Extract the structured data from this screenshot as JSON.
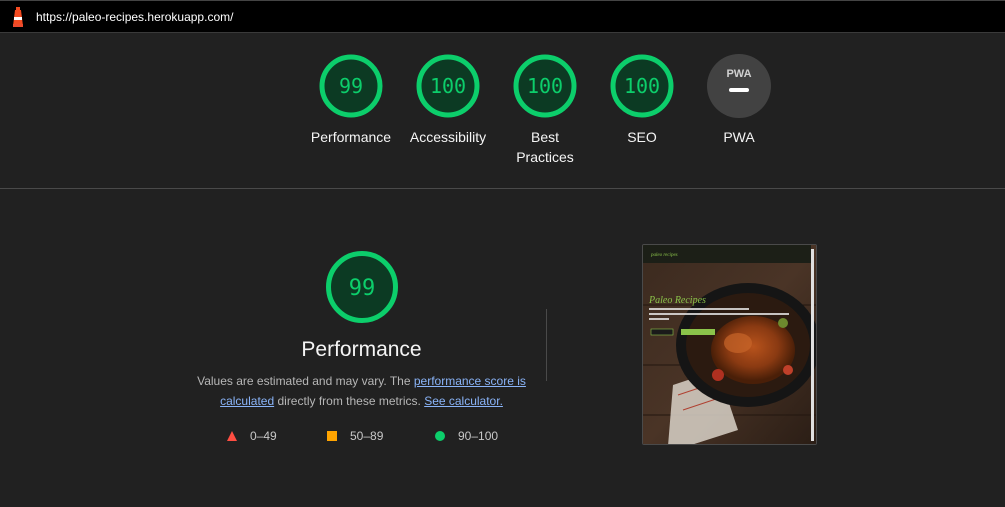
{
  "topbar": {
    "url": "https://paleo-recipes.herokuapp.com/",
    "logo_icon": "lighthouse-icon"
  },
  "gauges": [
    {
      "label": "Performance",
      "score": "99",
      "color": "#0cce6b"
    },
    {
      "label": "Accessibility",
      "score": "100",
      "color": "#0cce6b"
    },
    {
      "label": "Best Practices",
      "score": "100",
      "color": "#0cce6b"
    },
    {
      "label": "SEO",
      "score": "100",
      "color": "#0cce6b"
    },
    {
      "label": "PWA",
      "score": "",
      "icon": "pwa-icon"
    }
  ],
  "performance": {
    "score": "99",
    "title": "Performance",
    "desc_prefix": "Values are estimated and may vary. The ",
    "link_score": "performance score is calculated",
    "desc_middle": " directly from these metrics. ",
    "link_calc": "See calculator."
  },
  "legend": [
    {
      "range": "0–49",
      "shape": "triangle",
      "color": "#ff4e42"
    },
    {
      "range": "50–89",
      "shape": "square",
      "color": "#ffa400"
    },
    {
      "range": "90–100",
      "shape": "circle",
      "color": "#0cce6b"
    }
  ],
  "screenshot": {
    "brand": "paleo recipes",
    "hero_title": "Paleo Recipes",
    "hero_text": "A place to find and share recipes, search for and dish out this paleo-friendly meal ideas and recipes for eating healthy."
  },
  "colors": {
    "pass": "#0cce6b",
    "gauge_fill": "#0c3a23",
    "background": "#212121",
    "link": "#8ab4f8"
  }
}
